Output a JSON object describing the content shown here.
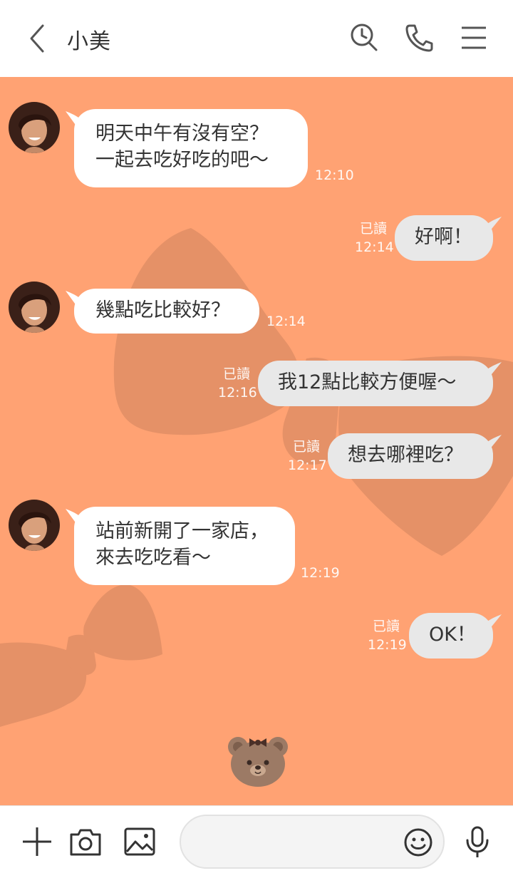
{
  "header": {
    "title": "小美",
    "icons": [
      "back-icon",
      "search-history-icon",
      "phone-icon",
      "menu-icon"
    ]
  },
  "messages": [
    {
      "side": "in",
      "lines": [
        "明天中午有沒有空？",
        "一起去吃好吃的吧～"
      ],
      "time": "12:10"
    },
    {
      "side": "out",
      "text": "好啊！",
      "read": "已讀",
      "time": "12:14"
    },
    {
      "side": "in",
      "lines": [
        "幾點吃比較好？"
      ],
      "time": "12:14"
    },
    {
      "side": "out",
      "text": "我12點比較方便喔～",
      "read": "已讀",
      "time": "12:16"
    },
    {
      "side": "out",
      "text": "想去哪裡吃？",
      "read": "已讀",
      "time": "12:17"
    },
    {
      "side": "in",
      "lines": [
        "站前新開了一家店，",
        "來去吃吃看～"
      ],
      "time": "12:19"
    },
    {
      "side": "out",
      "text": "OK！",
      "read": "已讀",
      "time": "12:19"
    }
  ],
  "sticker": "bear-face-sticker",
  "footer": {
    "input_placeholder": "",
    "icons": [
      "plus-icon",
      "camera-icon",
      "image-icon",
      "emoji-icon",
      "microphone-icon"
    ]
  },
  "colors": {
    "chat_background": "#FFA273",
    "decoration": "#E59167",
    "incoming_bubble": "#FFFFFF",
    "outgoing_bubble": "#E8E8E8"
  }
}
